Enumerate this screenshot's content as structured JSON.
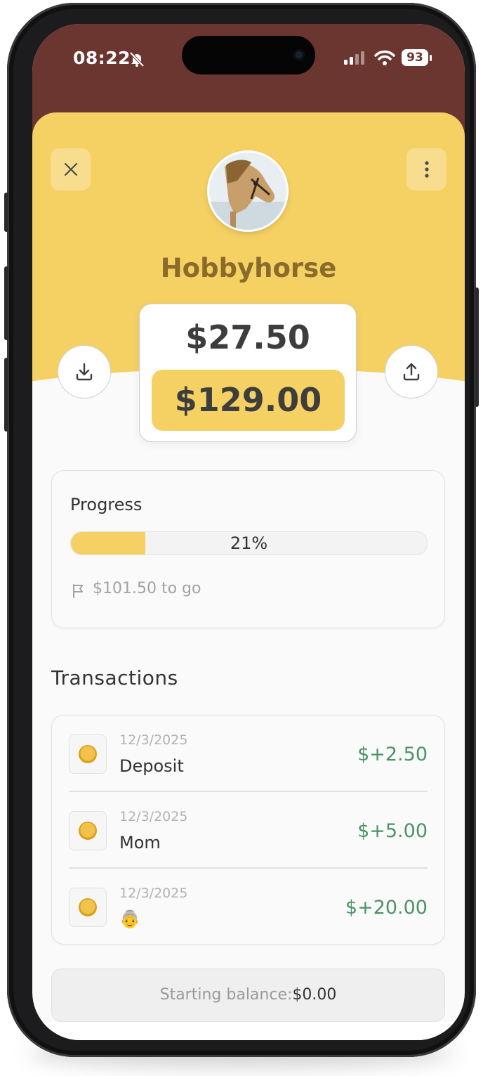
{
  "status_bar": {
    "time": "08:22",
    "battery": "93",
    "icons": [
      "bell-slash-icon",
      "signal-icon",
      "wifi-icon",
      "battery-icon"
    ]
  },
  "goal": {
    "name": "Hobbyhorse",
    "current_amount": "$27.50",
    "target_amount": "$129.00",
    "avatar": "hobbyhorse-photo"
  },
  "header_actions": {
    "close_icon": "close-icon",
    "more_icon": "more-vertical-icon",
    "deposit_icon": "download-icon",
    "withdraw_icon": "upload-icon"
  },
  "progress": {
    "label": "Progress",
    "percent_text": "21%",
    "fraction": 0.21,
    "remaining_text": "$101.50 to go",
    "flag_icon": "flag-icon"
  },
  "transactions": {
    "title": "Transactions",
    "items": [
      {
        "date": "12/3/2025",
        "description": "Deposit",
        "amount": "$+2.50"
      },
      {
        "date": "12/3/2025",
        "description": "Mom",
        "amount": "$+5.00"
      },
      {
        "date": "12/3/2025",
        "description": "👵",
        "amount": "$+20.00"
      }
    ]
  },
  "footer": {
    "label": "Starting balance:",
    "value": "$0.00"
  },
  "colors": {
    "accent": "#f5d063",
    "status_bar": "#6b3530",
    "positive": "#4a9463",
    "title_text": "#8a6b2a"
  }
}
